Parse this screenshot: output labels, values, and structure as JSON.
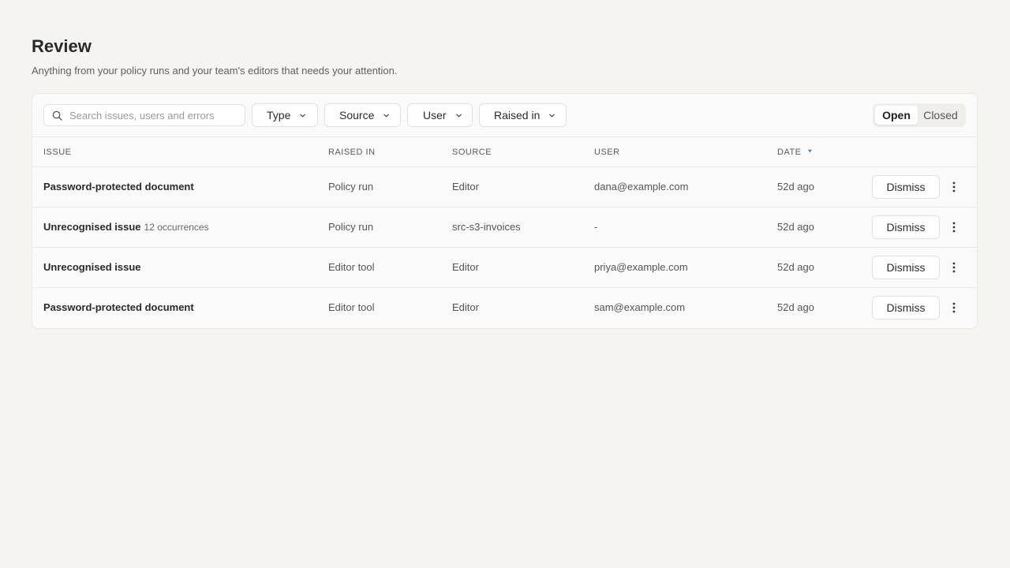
{
  "header": {
    "title": "Review",
    "subtitle": "Anything from your policy runs and your team's editors that needs your attention."
  },
  "toolbar": {
    "search_placeholder": "Search issues, users and errors",
    "search_value": "",
    "filters": {
      "type": "Type",
      "source": "Source",
      "user": "User",
      "raised_in": "Raised in"
    },
    "status_toggle": {
      "open": "Open",
      "closed": "Closed",
      "selected": "Open"
    }
  },
  "table": {
    "columns": {
      "issue": "ISSUE",
      "raised_in": "RAISED IN",
      "source": "SOURCE",
      "user": "USER",
      "date": "DATE"
    },
    "sort": {
      "column": "date",
      "direction": "descending"
    },
    "dismiss_label": "Dismiss",
    "rows": [
      {
        "issue": "Password-protected document",
        "occurrences": "",
        "raised_in": "Policy run",
        "source": "Editor",
        "user": "dana@example.com",
        "date": "52d ago"
      },
      {
        "issue": "Unrecognised issue",
        "occurrences": "12 occurrences",
        "raised_in": "Policy run",
        "source": "src-s3-invoices",
        "user": "-",
        "date": "52d ago"
      },
      {
        "issue": "Unrecognised issue",
        "occurrences": "",
        "raised_in": "Editor tool",
        "source": "Editor",
        "user": "priya@example.com",
        "date": "52d ago"
      },
      {
        "issue": "Password-protected document",
        "occurrences": "",
        "raised_in": "Editor tool",
        "source": "Editor",
        "user": "sam@example.com",
        "date": "52d ago"
      }
    ]
  },
  "icons": {
    "search": "search-icon",
    "chevron": "chevron-down-icon",
    "sort": "sort-desc-icon",
    "more": "more-vertical-icon"
  },
  "colors": {
    "background": "#f5f4f0",
    "panel": "#fafafa",
    "border": "#ebe9e5",
    "accent": "#3b82c4"
  }
}
